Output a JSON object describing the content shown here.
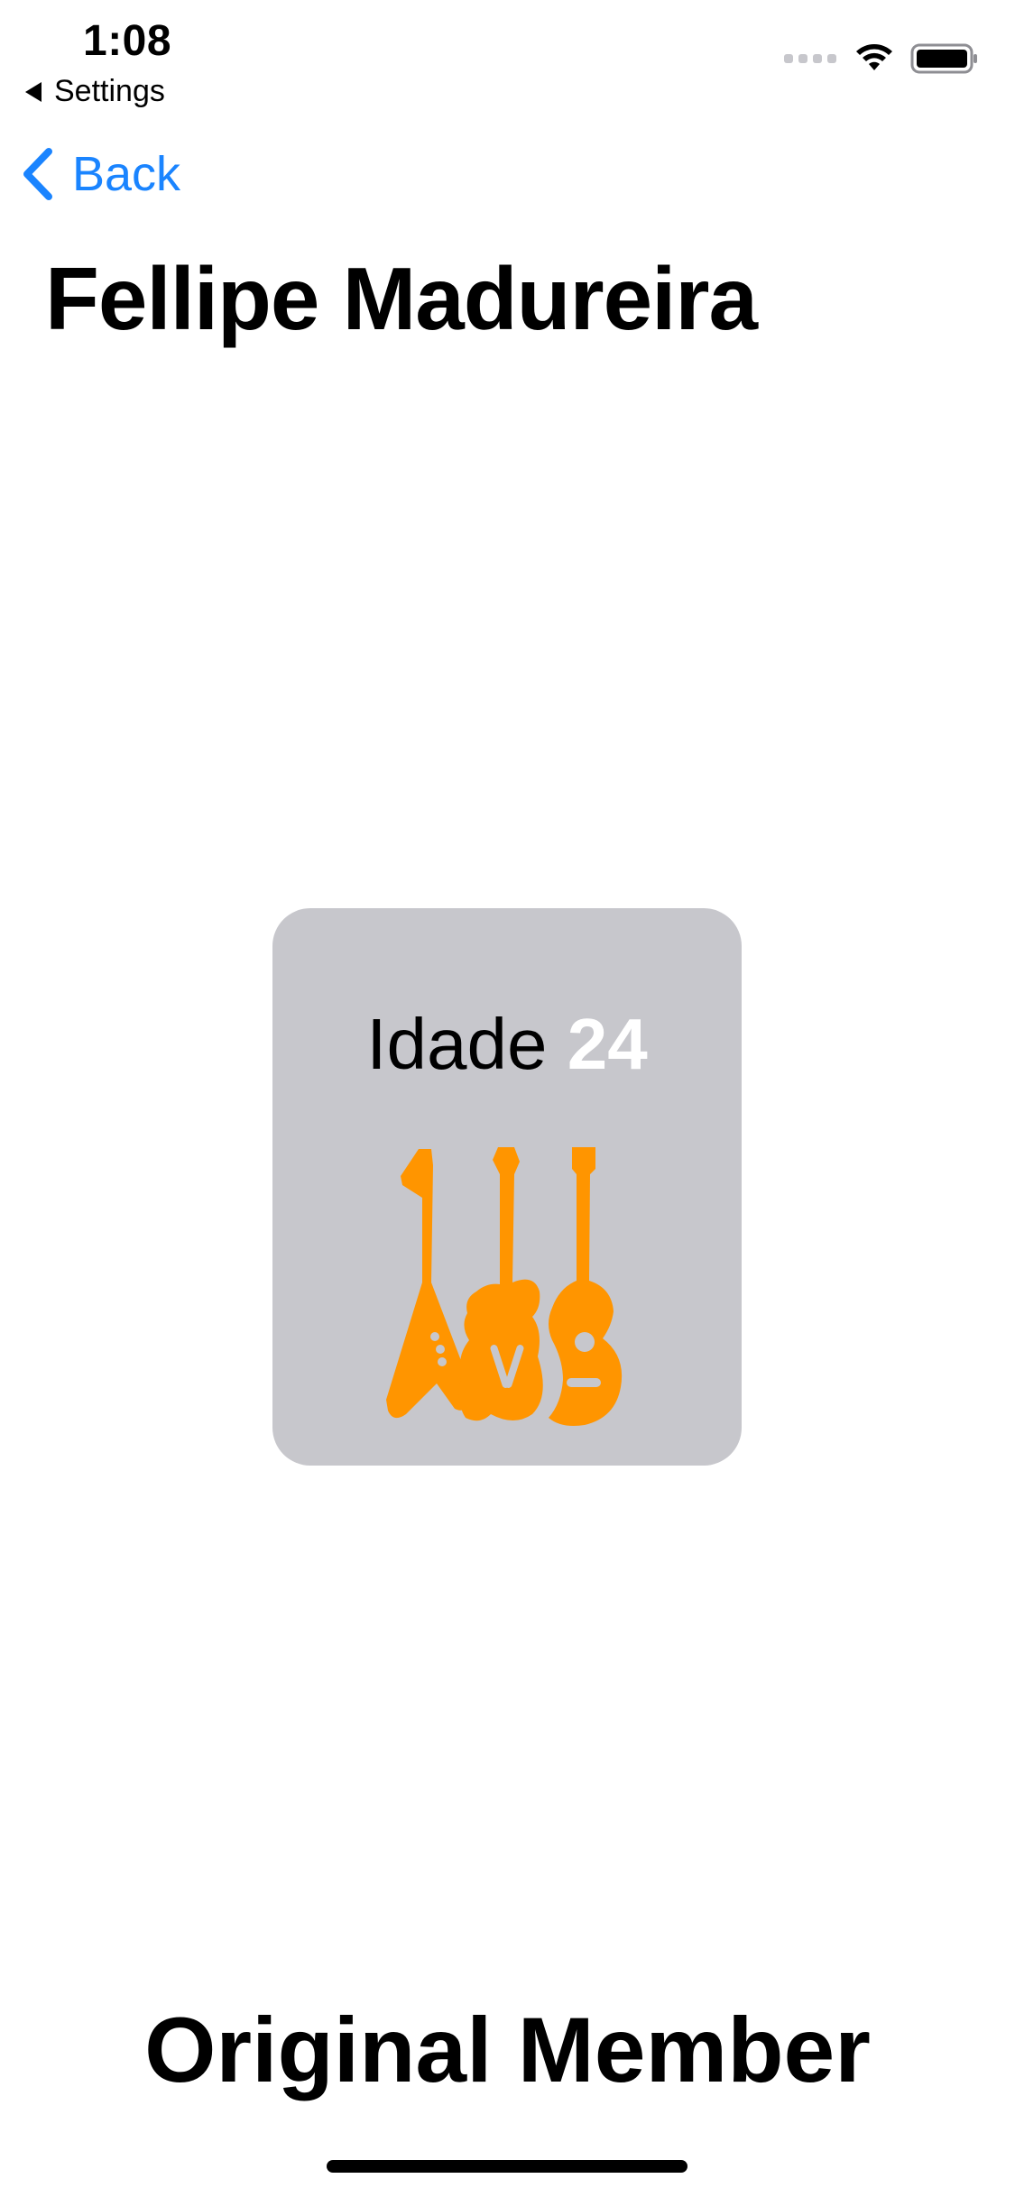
{
  "status_bar": {
    "time": "1:08",
    "return_app": "Settings",
    "icons": [
      "signal-dots-icon",
      "wifi-icon",
      "battery-icon"
    ]
  },
  "nav": {
    "back_label": "Back",
    "back_icon": "chevron-left-icon"
  },
  "member": {
    "name": "Fellipe Madureira",
    "age_label": "Idade",
    "age_value": "24",
    "icon": "guitars-icon",
    "status": "Original Member"
  },
  "colors": {
    "accent": "#1a84ff",
    "card_background": "#c7c7cc",
    "icon_orange": "#ff9500"
  }
}
